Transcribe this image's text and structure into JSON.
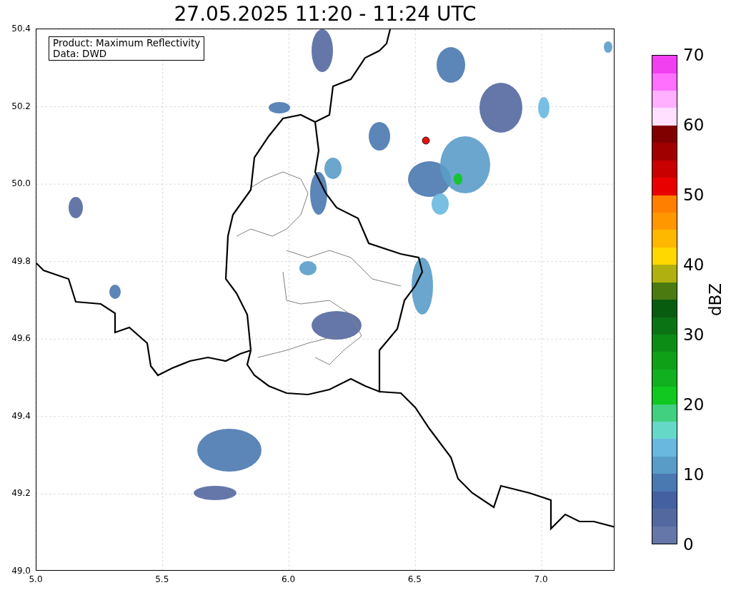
{
  "title": "27.05.2025 11:20 - 11:24 UTC",
  "info_box": [
    "Product: Maximum Reflectivity",
    "Data: DWD"
  ],
  "y_ticks": [
    "50.4",
    "50.2",
    "50.0",
    "49.8",
    "49.6",
    "49.4",
    "49.2",
    "49.0"
  ],
  "x_ticks": [
    "5.0",
    "5.5",
    "6.0",
    "6.5",
    "7.0"
  ],
  "colorbar": {
    "label": "dBZ",
    "ticks": [
      "70",
      "60",
      "50",
      "40",
      "30",
      "20",
      "10",
      "0"
    ]
  }
}
